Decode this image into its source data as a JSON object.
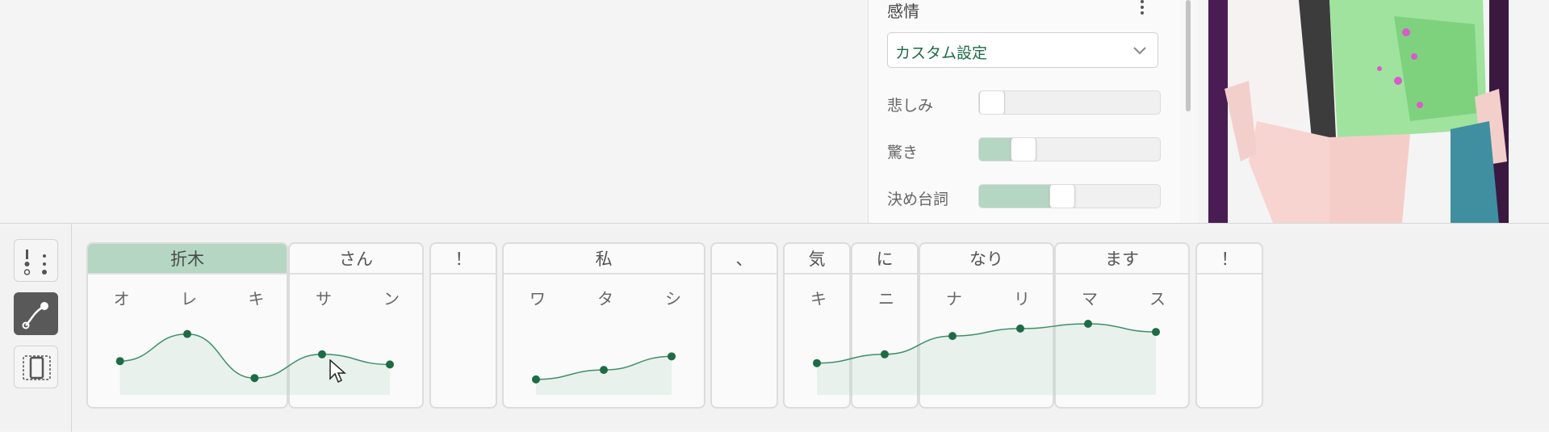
{
  "emotion_panel": {
    "title": "感情",
    "preset": "カスタム設定",
    "sliders": [
      {
        "label": "悲しみ",
        "value": 0.0
      },
      {
        "label": "驚き",
        "value": 0.2
      },
      {
        "label": "決め台詞",
        "value": 0.45
      }
    ]
  },
  "toolbar": {
    "tools": [
      {
        "name": "accent-tool-icon",
        "active": false
      },
      {
        "name": "pitch-curve-tool-icon",
        "active": true
      },
      {
        "name": "length-tool-icon",
        "active": false
      }
    ]
  },
  "phrases": [
    {
      "text": "折木",
      "selected": true,
      "moras": [
        "オ",
        "レ",
        "キ"
      ]
    },
    {
      "text": "さん",
      "selected": false,
      "moras": [
        "サ",
        "ン"
      ]
    },
    {
      "text": "！",
      "selected": false,
      "moras": []
    },
    {
      "text": "私",
      "selected": false,
      "moras": [
        "ワ",
        "タ",
        "シ"
      ]
    },
    {
      "text": "、",
      "selected": false,
      "moras": []
    },
    {
      "text": "気",
      "selected": false,
      "moras": [
        "キ"
      ]
    },
    {
      "text": "に",
      "selected": false,
      "moras": [
        "ニ"
      ]
    },
    {
      "text": "なり",
      "selected": false,
      "moras": [
        "ナ",
        "リ"
      ]
    },
    {
      "text": "ます",
      "selected": false,
      "moras": [
        "マ",
        "ス"
      ]
    },
    {
      "text": "！",
      "selected": false,
      "moras": []
    }
  ],
  "pitch_groups": [
    [
      0.45,
      0.85,
      0.2,
      0.55,
      0.4
    ],
    [
      0.18,
      0.32,
      0.52
    ],
    [
      0.42,
      0.55,
      0.82,
      0.93,
      1.0,
      0.88
    ]
  ],
  "colors": {
    "accent": "#1e6b45",
    "selected_header": "#b4d6c2",
    "curve": "#3f8f68"
  }
}
